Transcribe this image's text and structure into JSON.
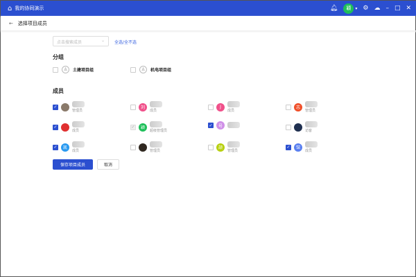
{
  "app": {
    "title": "我的协同演示",
    "avatar_text": "颖"
  },
  "subheader": {
    "title": "选择项目成员"
  },
  "search": {
    "placeholder": "点击搜索成员"
  },
  "select_links": "全选/全不选",
  "groups_heading": "分组",
  "groups": [
    {
      "label": "土建项目组"
    },
    {
      "label": "机电项目组"
    }
  ],
  "members_heading": "成员",
  "members": [
    {
      "avatar": "",
      "color": "#8a7a6a",
      "role": "管理员",
      "checked": true
    },
    {
      "avatar": "刘",
      "color": "#f0508a",
      "role": "成员",
      "checked": false
    },
    {
      "avatar": "J",
      "color": "#f0508a",
      "role": "成员",
      "checked": false
    },
    {
      "avatar": "志",
      "color": "#f0502a",
      "role": "管理员",
      "checked": false
    },
    {
      "avatar": "",
      "color": "#e03030",
      "role": "成员",
      "checked": true
    },
    {
      "avatar": "颖",
      "color": "#1fbf5a",
      "role": "超级管理员",
      "checked": true,
      "disabled": true
    },
    {
      "avatar": "号",
      "color": "#d090e8",
      "role": "",
      "checked": true
    },
    {
      "avatar": "",
      "color": "#203050",
      "role": "访客",
      "checked": false
    },
    {
      "avatar": "凯",
      "color": "#2a9af0",
      "role": "成员",
      "checked": true
    },
    {
      "avatar": "",
      "color": "#302820",
      "role": "管理员",
      "checked": false
    },
    {
      "avatar": "颉",
      "color": "#b8d010",
      "role": "管理员",
      "checked": false
    },
    {
      "avatar": "馆",
      "color": "#5a80f0",
      "role": "成员",
      "checked": true
    }
  ],
  "buttons": {
    "save": "保存项目成员",
    "cancel": "取消"
  }
}
